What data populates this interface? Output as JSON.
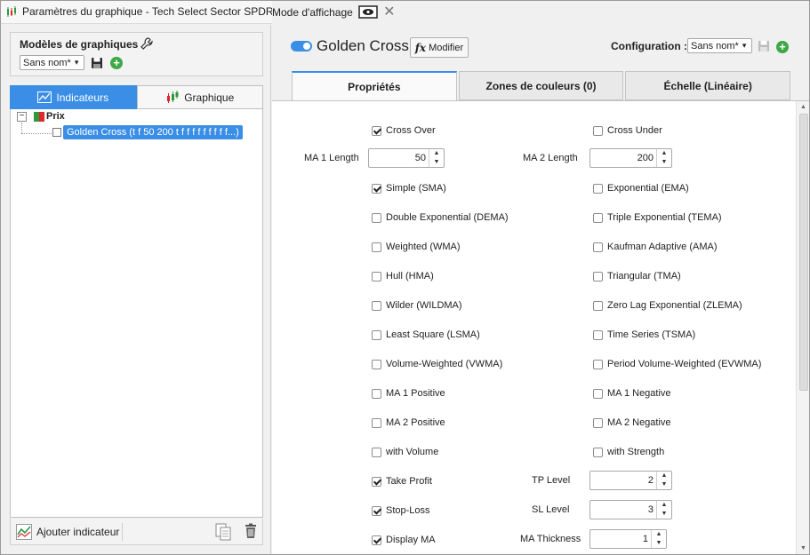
{
  "window": {
    "title": "Paramètres du graphique - Tech Select Sector SPDR Fund Journalier",
    "display_mode_label": "Mode d'affichage",
    "close_glyph": "✕"
  },
  "templates": {
    "label": "Modèles de graphiques",
    "selected": "Sans nom*"
  },
  "left_tabs": [
    {
      "label": "Indicateurs"
    },
    {
      "label": "Graphique"
    }
  ],
  "tree": {
    "root_label": "Prix",
    "expander": "−",
    "child_label": "Golden Cross (t f 50 200 t f f f f f f f f f...)"
  },
  "bottom": {
    "add_indicator_label": "Ajouter indicateur"
  },
  "study": {
    "name": "Golden Cross",
    "fx": "fx",
    "modify_label": "Modifier",
    "config_label": "Configuration :",
    "config_selected": "Sans nom*"
  },
  "right_tabs": [
    {
      "label": "Propriétés"
    },
    {
      "label": "Zones de couleurs (0)"
    },
    {
      "label": "Échelle (Linéaire)"
    }
  ],
  "properties": {
    "cross_over": {
      "label": "Cross Over",
      "checked": true
    },
    "cross_under": {
      "label": "Cross Under",
      "checked": false
    },
    "ma1_length": {
      "label": "MA 1 Length",
      "value": "50"
    },
    "ma2_length": {
      "label": "MA 2 Length",
      "value": "200"
    },
    "left_checks": [
      {
        "label": "Simple (SMA)",
        "checked": true
      },
      {
        "label": "Double Exponential (DEMA)",
        "checked": false
      },
      {
        "label": "Weighted (WMA)",
        "checked": false
      },
      {
        "label": "Hull (HMA)",
        "checked": false
      },
      {
        "label": "Wilder (WILDMA)",
        "checked": false
      },
      {
        "label": "Least Square (LSMA)",
        "checked": false
      },
      {
        "label": "Volume-Weighted (VWMA)",
        "checked": false
      },
      {
        "label": "MA 1 Positive",
        "checked": false
      },
      {
        "label": "MA 2 Positive",
        "checked": false
      },
      {
        "label": "with Volume",
        "checked": false
      }
    ],
    "right_checks": [
      {
        "label": "Exponential (EMA)",
        "checked": false
      },
      {
        "label": "Triple Exponential (TEMA)",
        "checked": false
      },
      {
        "label": "Kaufman Adaptive (AMA)",
        "checked": false
      },
      {
        "label": "Triangular (TMA)",
        "checked": false
      },
      {
        "label": "Zero Lag Exponential (ZLEMA)",
        "checked": false
      },
      {
        "label": "Time Series (TSMA)",
        "checked": false
      },
      {
        "label": "Period Volume-Weighted (EVWMA)",
        "checked": false
      },
      {
        "label": "MA 1 Negative",
        "checked": false
      },
      {
        "label": "MA 2 Negative",
        "checked": false
      },
      {
        "label": "with Strength",
        "checked": false
      }
    ],
    "take_profit": {
      "label": "Take Profit",
      "checked": true
    },
    "stop_loss": {
      "label": "Stop-Loss",
      "checked": true
    },
    "display_ma": {
      "label": "Display MA",
      "checked": true
    },
    "tp_level": {
      "label": "TP Level",
      "value": "2"
    },
    "sl_level": {
      "label": "SL Level",
      "value": "3"
    },
    "ma_thickness": {
      "label": "MA Thickness",
      "value": "1"
    }
  },
  "colors": {
    "accent": "#3a8ee6",
    "add_green": "#3da845"
  }
}
